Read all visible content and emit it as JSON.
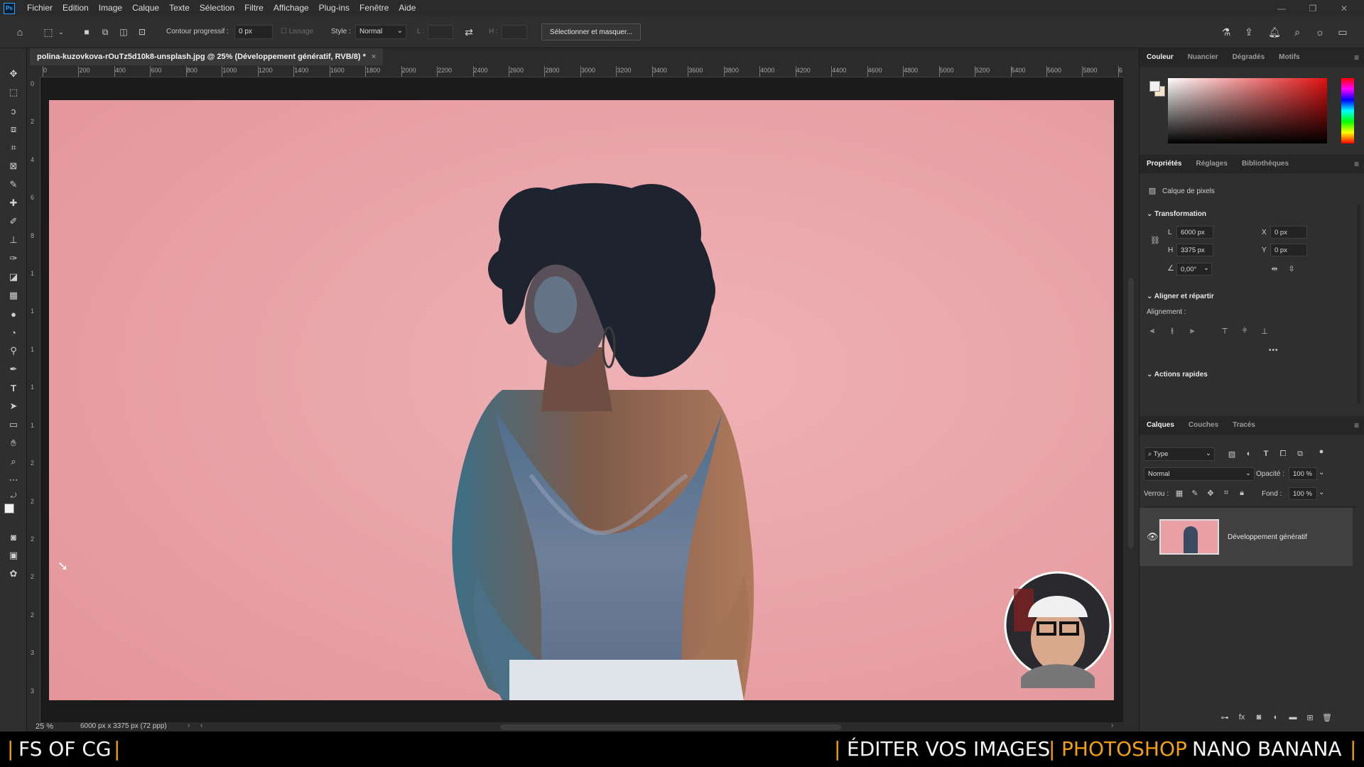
{
  "app": {
    "logo": "Ps",
    "menu": [
      "Fichier",
      "Edition",
      "Image",
      "Calque",
      "Texte",
      "Sélection",
      "Filtre",
      "Affichage",
      "Plug-ins",
      "Fenêtre",
      "Aide"
    ]
  },
  "options": {
    "contour_label": "Contour progressif :",
    "contour_value": "0 px",
    "lissage_label": "Lissage",
    "style_label": "Style :",
    "style_value": "Normal",
    "l_label": "L :",
    "h_label": "H :",
    "select_mask_button": "Sélectionner et masquer..."
  },
  "document": {
    "tab_title": "polina-kuzovkova-rOuTz5d10k8-unsplash.jpg @ 25% (Développement génératif, RVB/8) *",
    "close": "×",
    "ruler_top": [
      "0",
      "200",
      "400",
      "600",
      "800",
      "1000",
      "1200",
      "1400",
      "1600",
      "1800",
      "2000",
      "2200",
      "2400",
      "2600",
      "2800",
      "3000",
      "3200",
      "3400",
      "3600",
      "3800",
      "4000",
      "4200",
      "4400",
      "4600",
      "4800",
      "5000",
      "5200",
      "5400",
      "5600",
      "5800",
      "6"
    ],
    "ruler_left": [
      "0",
      "2",
      "4",
      "6",
      "8",
      "1",
      "1",
      "1",
      "1",
      "1",
      "2",
      "2",
      "2",
      "2",
      "2",
      "3",
      "3"
    ],
    "zoom": "25 %",
    "doc_info": "6000 px x 3375 px (72 ppp)"
  },
  "colors": {
    "canvas_bg": "#e9a0a4",
    "accent": "#31a8ff",
    "caption_accent": "#f2a012"
  },
  "color_panel": {
    "tabs": [
      "Couleur",
      "Nuancier",
      "Dégradés",
      "Motifs"
    ]
  },
  "properties_panel": {
    "tabs": [
      "Propriétés",
      "Réglages",
      "Bibliothèques"
    ],
    "layer_type": "Calque de pixels",
    "transform_title": "Transformation",
    "w_label": "L",
    "w_value": "6000 px",
    "h_label": "H",
    "h_value": "3375 px",
    "x_label": "X",
    "x_value": "0 px",
    "y_label": "Y",
    "y_value": "0 px",
    "angle_value": "0,00°",
    "align_title": "Aligner et répartir",
    "align_label": "Alignement :",
    "more": "•••",
    "quick_actions_title": "Actions rapides"
  },
  "layers_panel": {
    "tabs": [
      "Calques",
      "Couches",
      "Tracés"
    ],
    "filter_value": "Type",
    "blend_mode": "Normal",
    "opacity_label": "Opacité :",
    "opacity_value": "100 %",
    "lock_label": "Verrou :",
    "fill_label": "Fond :",
    "fill_value": "100 %",
    "layers": [
      {
        "name": "Développement génératif",
        "visible": true
      }
    ]
  },
  "caption": {
    "left_sep": "|",
    "left_text": "FS OF CG",
    "left_sep2": "|",
    "sep1": "|",
    "text1": "ÉDITER VOS IMAGES",
    "sep2": "|",
    "text2": "PHOTOSHOP",
    "text3": "NANO BANANA",
    "sep3": "|"
  }
}
